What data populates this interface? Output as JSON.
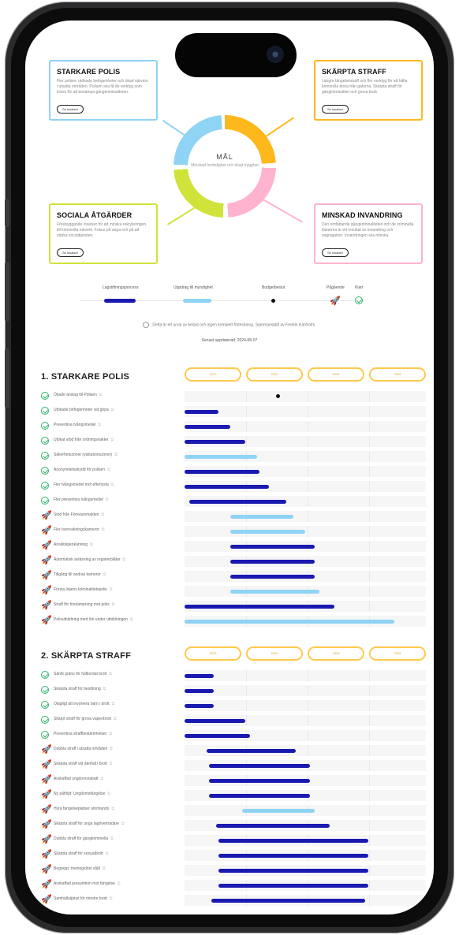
{
  "colors": {
    "policy_primary": "#1a1ab0",
    "policy_secondary": "#8fd3f5",
    "polis": "#8fd3f5",
    "straff": "#ffb81c",
    "sociala": "#cfe33b",
    "invandring": "#ffb3cf",
    "done": "#2db36a",
    "planned": "#ffb81c"
  },
  "goals": {
    "polis": {
      "title": "STARKARE POLIS",
      "text": "Fler poliser, utökade befogenheter och ökad närvaro i utsatta områden. Polisen ska få de verktyg som krävs för att bekämpa gängkriminaliteten.",
      "button": "Se insatser"
    },
    "straff": {
      "title": "SKÄRPTA STRAFF",
      "text": "Längre fängelsestraff och fler verktyg för att hålla kriminella borta från gatorna. Skärpta straff för gängkriminalitet och grova brott.",
      "button": "Se insatser"
    },
    "sociala": {
      "title": "SOCIALA ÅTGÄRDER",
      "text": "Förebyggande insatser för att minska rekryteringen till kriminella nätverk. Fokus på unga och på att stärka socialtjänsten.",
      "button": "Se insatser"
    },
    "invandring": {
      "title": "MINSKAD INVANDRING",
      "text": "Den omfattande gängkriminaliteten och de kriminella klanerna är ett resultat av invandring och segregation. Invandringen ska minska.",
      "button": "Se insatser"
    }
  },
  "center": {
    "title": "MÅL",
    "subtitle": "Minskad brottslighet och ökad trygghet"
  },
  "legend": {
    "items": [
      {
        "label": "Lagstiftningsprocess",
        "type": "bar",
        "color": "#1a1ab0"
      },
      {
        "label": "Uppdrag till myndighet",
        "type": "bar",
        "color": "#8fd3f5"
      },
      {
        "label": "Budgetbeslut",
        "type": "dot"
      },
      {
        "label": "Pågående",
        "type": "icon",
        "icon": "rocket-icon"
      },
      {
        "label": "Klart",
        "type": "icon",
        "icon": "check-circle-icon"
      }
    ]
  },
  "note": "Detta är ett urval av beslut och ingen komplett förteckning. Sammanställt av Fredrik Kärrholm.",
  "updated": "Senast uppdaterad: 2024-08-07",
  "years": [
    "2023",
    "2024",
    "2025",
    "2026"
  ],
  "sections": [
    {
      "title": "1. STARKARE POLIS",
      "rows": [
        {
          "label": "Ökade anslag till Polisen",
          "status": "done",
          "type": "dot",
          "start": 0.38
        },
        {
          "label": "Utökade befogenheter vid gripa",
          "status": "done",
          "type": "bar",
          "color": "primary",
          "start": 0.0,
          "end": 0.14
        },
        {
          "label": "Preventiva tvångsmedel",
          "status": "done",
          "type": "bar",
          "color": "primary",
          "start": 0.0,
          "end": 0.19
        },
        {
          "label": "Utökat stöd från ordningsvakter",
          "status": "done",
          "type": "bar",
          "color": "primary",
          "start": 0.0,
          "end": 0.25
        },
        {
          "label": "Säkerhetszoner (visitationszoner)",
          "status": "done",
          "type": "bar",
          "color": "secondary",
          "start": 0.0,
          "end": 0.3
        },
        {
          "label": "Anonymitetsskydd för polisen",
          "status": "done",
          "type": "bar",
          "color": "primary",
          "start": 0.0,
          "end": 0.31
        },
        {
          "label": "Fler tvångsmedel mot efterlysta",
          "status": "done",
          "type": "bar",
          "color": "primary",
          "start": 0.0,
          "end": 0.35
        },
        {
          "label": "Fler preventiva tvångsmedel",
          "status": "done",
          "type": "bar",
          "color": "primary",
          "start": 0.02,
          "end": 0.42
        },
        {
          "label": "Stöd från Försvarsmakten",
          "status": "planned",
          "type": "bar",
          "color": "secondary",
          "start": 0.19,
          "end": 0.45
        },
        {
          "label": "Fler övervakningskameror",
          "status": "planned",
          "type": "bar",
          "color": "secondary",
          "start": 0.19,
          "end": 0.5
        },
        {
          "label": "Ansiktsigenkänning",
          "status": "planned",
          "type": "bar",
          "color": "primary",
          "start": 0.19,
          "end": 0.54
        },
        {
          "label": "Automatisk avläsning av registerplåtar",
          "status": "planned",
          "type": "bar",
          "color": "primary",
          "start": 0.19,
          "end": 0.54
        },
        {
          "label": "Tillgång till andras kameror",
          "status": "planned",
          "type": "bar",
          "color": "primary",
          "start": 0.19,
          "end": 0.54
        },
        {
          "label": "Första linjens kriminalitetspolis",
          "status": "planned",
          "type": "bar",
          "color": "secondary",
          "start": 0.19,
          "end": 0.56
        },
        {
          "label": "Straff för förolämpning mot polis",
          "status": "planned",
          "type": "bar",
          "color": "primary",
          "start": 0.0,
          "end": 0.62
        },
        {
          "label": "Polisutbildning med lön under utbildningen",
          "status": "planned",
          "type": "bar",
          "color": "secondary",
          "start": 0.0,
          "end": 0.87
        }
      ]
    },
    {
      "title": "2. SKÄRPTA STRAFF",
      "rows": [
        {
          "label": "Sänkt gräns för fullbordat brott",
          "status": "done",
          "type": "bar",
          "color": "primary",
          "start": 0.0,
          "end": 0.12
        },
        {
          "label": "Skärpta straff för besittning",
          "status": "done",
          "type": "bar",
          "color": "primary",
          "start": 0.0,
          "end": 0.12
        },
        {
          "label": "Olagligt att involvera barn i brott",
          "status": "done",
          "type": "bar",
          "color": "primary",
          "start": 0.0,
          "end": 0.12
        },
        {
          "label": "Skärpt straff för grova vapenbrott",
          "status": "done",
          "type": "bar",
          "color": "primary",
          "start": 0.0,
          "end": 0.25
        },
        {
          "label": "Preventiva straffbestämmelser",
          "status": "done",
          "type": "bar",
          "color": "primary",
          "start": 0.0,
          "end": 0.27
        },
        {
          "label": "Dubbla straff i utsatta områden",
          "status": "planned",
          "type": "bar",
          "color": "primary",
          "start": 0.09,
          "end": 0.46
        },
        {
          "label": "Skärpta straff vid återfall i brott",
          "status": "planned",
          "type": "bar",
          "color": "primary",
          "start": 0.1,
          "end": 0.52
        },
        {
          "label": "Avskaffad ungdomsrabatt",
          "status": "planned",
          "type": "bar",
          "color": "primary",
          "start": 0.1,
          "end": 0.52
        },
        {
          "label": "Ny påföljd: Ungdomsfängelse",
          "status": "planned",
          "type": "bar",
          "color": "primary",
          "start": 0.1,
          "end": 0.52
        },
        {
          "label": "Hyra fängelseplatser utomlands",
          "status": "planned",
          "type": "bar",
          "color": "secondary",
          "start": 0.24,
          "end": 0.54
        },
        {
          "label": "Skärpta straff för unga lagöverträdare",
          "status": "planned",
          "type": "bar",
          "color": "primary",
          "start": 0.13,
          "end": 0.6
        },
        {
          "label": "Dubbla straff för gängkriminella",
          "status": "planned",
          "type": "bar",
          "color": "primary",
          "start": 0.14,
          "end": 0.76
        },
        {
          "label": "Skärpta straff för sexualbrott",
          "status": "planned",
          "type": "bar",
          "color": "primary",
          "start": 0.14,
          "end": 0.76
        },
        {
          "label": "Begrepp: meningslöst våld",
          "status": "planned",
          "type": "bar",
          "color": "primary",
          "start": 0.14,
          "end": 0.76
        },
        {
          "label": "Avskaffad presumtion mot fängelse",
          "status": "planned",
          "type": "bar",
          "color": "primary",
          "start": 0.14,
          "end": 0.76
        },
        {
          "label": "Samhällstjänst för mindre brott",
          "status": "planned",
          "type": "bar",
          "color": "primary",
          "start": 0.11,
          "end": 0.75
        }
      ]
    }
  ]
}
